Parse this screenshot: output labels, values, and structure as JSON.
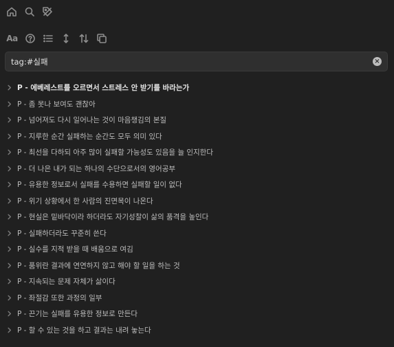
{
  "nav_icons": [
    "home-icon",
    "search-icon",
    "tag-icon"
  ],
  "toolbar_icons": [
    "font-size-icon",
    "help-icon",
    "list-icon",
    "vertical-arrows-icon",
    "sort-icon",
    "copy-icon"
  ],
  "toolbar": {
    "font_label": "Aa"
  },
  "search": {
    "value": "tag:#실패",
    "clear_icon": "clear-icon"
  },
  "items": [
    "P - 에베레스트를 오르면서 스트레스 안 받기를 바라는가",
    "P - 좀 못나 보여도 괜찮아",
    "P - 넘어져도 다시 일어나는 것이 마음챙김의 본질",
    "P - 지루한 순간 실패하는 순간도 모두 의미 있다",
    "P - 최선을 다하되 아주 많이 실패할 가능성도 있음을 늘 인지한다",
    "P - 더 나은 내가 되는 하나의 수단으로서의 영어공부",
    "P - 유용한 정보로서 실패를 수용하면 실패할 일이 없다",
    "P - 위기 상황에서 한 사람의 진면목이 나온다",
    "P - 현실은 밑바닥이라 하더라도 자기성찰이 삶의 품격을 높인다",
    "P - 실패하더라도 꾸준히 쓴다",
    "P - 실수를 지적 받을 때 배움으로 여김",
    "P - 품위란 결과에 연연하지 않고 해야 할 일을 하는 것",
    "P - 지속되는 문제 자체가 삶이다",
    "P - 좌절감 또한 과정의 일부",
    "P - 끈기는 실패를 유용한 정보로 만든다",
    "P - 할 수 있는 것을 하고 결과는 내려 놓는다"
  ]
}
